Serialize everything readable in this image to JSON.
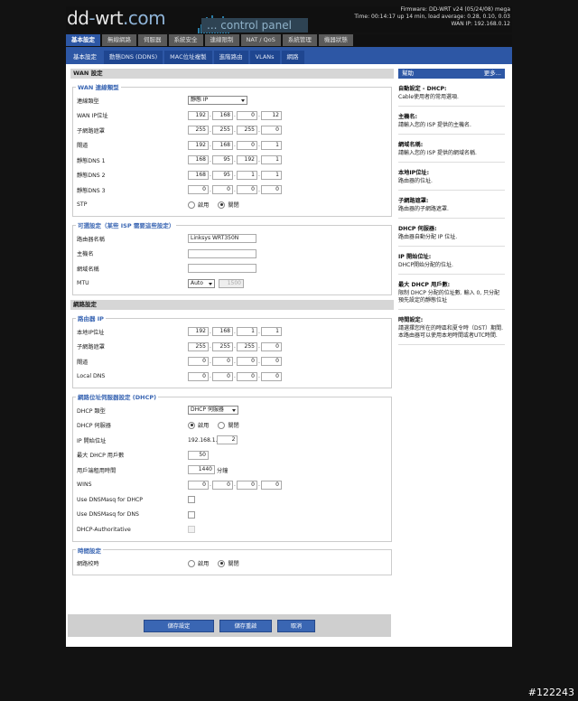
{
  "header": {
    "logo_a": "dd",
    "logo_sep": "-",
    "logo_b": "wrt",
    "logo_c": ".com",
    "control_panel": "... control panel",
    "firmware": "Firmware: DD-WRT v24 (05/24/08) mega",
    "time": "Time: 00:14:17 up 14 min, load average: 0.28, 0.10, 0.03",
    "wan_ip": "WAN IP: 192.168.0.12"
  },
  "nav": {
    "tabs": [
      "基本設定",
      "無線網路",
      "伺服器",
      "系統安全",
      "連線限制",
      "NAT / QoS",
      "系統管理",
      "機器狀態"
    ],
    "subtabs": [
      "基本設定",
      "動態DNS (DDNS)",
      "MAC位址複製",
      "進階路由",
      "VLANs",
      "網路"
    ]
  },
  "wan": {
    "section": "WAN 設定",
    "conn_legend": "WAN 連線類型",
    "conn_type_label": "連線類型",
    "conn_type_value": "靜態 IP",
    "wan_ip_label": "WAN IP位址",
    "wan_ip": [
      "192",
      "168",
      "0",
      "12"
    ],
    "mask_label": "子網路遮罩",
    "mask": [
      "255",
      "255",
      "255",
      "0"
    ],
    "gw_label": "閘道",
    "gw": [
      "192",
      "168",
      "0",
      "1"
    ],
    "dns1_label": "靜態DNS 1",
    "dns1": [
      "168",
      "95",
      "192",
      "1"
    ],
    "dns2_label": "靜態DNS 2",
    "dns2": [
      "168",
      "95",
      "1",
      "1"
    ],
    "dns3_label": "靜態DNS 3",
    "dns3": [
      "0",
      "0",
      "0",
      "0"
    ],
    "stp_label": "STP",
    "enable": "啟用",
    "disable": "關閉",
    "opt_legend": "可選設定（某些 ISP 需要這些設定）",
    "router_name_label": "路由器名稱",
    "router_name": "Linksys WRT350N",
    "host_label": "主機名",
    "domain_label": "網域名稱",
    "mtu_label": "MTU",
    "mtu_mode": "Auto",
    "mtu_value": "1500"
  },
  "net": {
    "section": "網路設定",
    "router_ip_legend": "路由器 IP",
    "local_ip_label": "本地IP位址",
    "local_ip": [
      "192",
      "168",
      "1",
      "1"
    ],
    "mask_label": "子網路遮罩",
    "mask": [
      "255",
      "255",
      "255",
      "0"
    ],
    "gw_label": "閘道",
    "gw": [
      "0",
      "0",
      "0",
      "0"
    ],
    "localdns_label": "Local DNS",
    "localdns": [
      "0",
      "0",
      "0",
      "0"
    ],
    "dhcp_legend": "網路位址伺服器設定 (DHCP)",
    "dhcp_type_label": "DHCP 類型",
    "dhcp_type": "DHCP 伺服器",
    "dhcp_server_label": "DHCP 伺服器",
    "start_label": "IP 開始位址",
    "start_prefix": "192.168.1.",
    "start_value": "2",
    "max_label": "最大 DHCP 用戶數",
    "max_value": "50",
    "lease_label": "用戶端租用時間",
    "lease_value": "1440",
    "lease_unit": "分鐘",
    "wins_label": "WINS",
    "wins": [
      "0",
      "0",
      "0",
      "0"
    ],
    "dnsmasq_dhcp_label": "Use DNSMasq for DHCP",
    "dnsmasq_dns_label": "Use DNSMasq for DNS",
    "dhcp_auth_label": "DHCP-Authoritative",
    "time_legend": "時間設定",
    "ntp_label": "網路校時"
  },
  "buttons": {
    "save": "儲存設定",
    "apply": "儲存重啟",
    "cancel": "取消"
  },
  "help": {
    "title": "幫助",
    "more": "更多...",
    "items": [
      {
        "t": "自動設定 - DHCP:",
        "b": "Cable使用者的常用選項."
      },
      {
        "t": "主機名:",
        "b": "請輸入您的 ISP 提供的主機名."
      },
      {
        "t": "網域名稱:",
        "b": "請輸入您的 ISP 提供的網域名稱."
      },
      {
        "t": "本地IP位址:",
        "b": "路由器的位址."
      },
      {
        "t": "子網路遮罩:",
        "b": "路由器的子網路遮罩."
      },
      {
        "t": "DHCP 伺服器:",
        "b": "路由器自動分配 IP 位址."
      },
      {
        "t": "IP 開始位址:",
        "b": "DHCP開始分配的位址."
      },
      {
        "t": "最大 DHCP 用戶數:",
        "b": "限制 DHCP 分配的位址數. 輸入 0, 只分配預先設定的靜態位址"
      },
      {
        "t": "時間設定:",
        "b": "請選擇您所在的時區和夏令時（DST）期間. 本路由器可以使用本地時間或者UTC時間."
      }
    ]
  },
  "watermark": "#122243"
}
